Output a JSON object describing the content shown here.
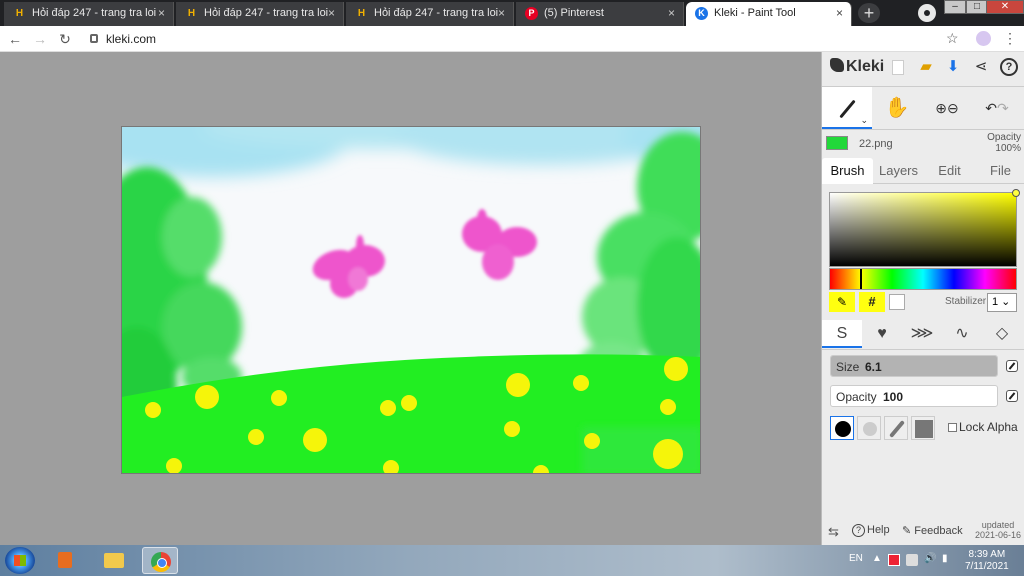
{
  "browser": {
    "tabs": [
      {
        "title": "Hỏi đáp 247 - trang tra loi",
        "favicon": "h-icon"
      },
      {
        "title": "Hỏi đáp 247 - trang tra loi",
        "favicon": "h-icon"
      },
      {
        "title": "Hỏi đáp 247 - trang tra loi",
        "favicon": "h-icon"
      },
      {
        "title": "(5) Pinterest",
        "favicon": "pinterest-icon"
      },
      {
        "title": "Kleki - Paint Tool",
        "favicon": "kleki-icon",
        "active": true
      }
    ],
    "url": "kleki.com"
  },
  "panel": {
    "logo": "Kleki",
    "layer": {
      "name": "22.png",
      "opacity_label": "Opacity",
      "opacity_value": "100%"
    },
    "tabs": [
      "Brush",
      "Layers",
      "Edit",
      "File"
    ],
    "active_tab": "Brush",
    "color": {
      "primary": "#ffff00",
      "secondary": "#ffffff",
      "hex_button": "#"
    },
    "stabilizer": {
      "label": "Stabilizer",
      "value": "1"
    },
    "size": {
      "label": "Size",
      "value": "6.1"
    },
    "opacity": {
      "label": "Opacity",
      "value": "100"
    },
    "lock_alpha": "Lock Alpha",
    "footer": {
      "help": "Help",
      "feedback": "Feedback",
      "updated_label": "updated",
      "updated_date": "2021-06-16"
    }
  },
  "taskbar": {
    "language": "EN",
    "time": "8:39 AM",
    "date": "7/11/2021"
  },
  "colors": {
    "canvas_grass": "#22ee22",
    "flower_yellow": "#f5f50a",
    "butterfly_pink": "#ee55cc",
    "accent": "#1a73e8"
  }
}
